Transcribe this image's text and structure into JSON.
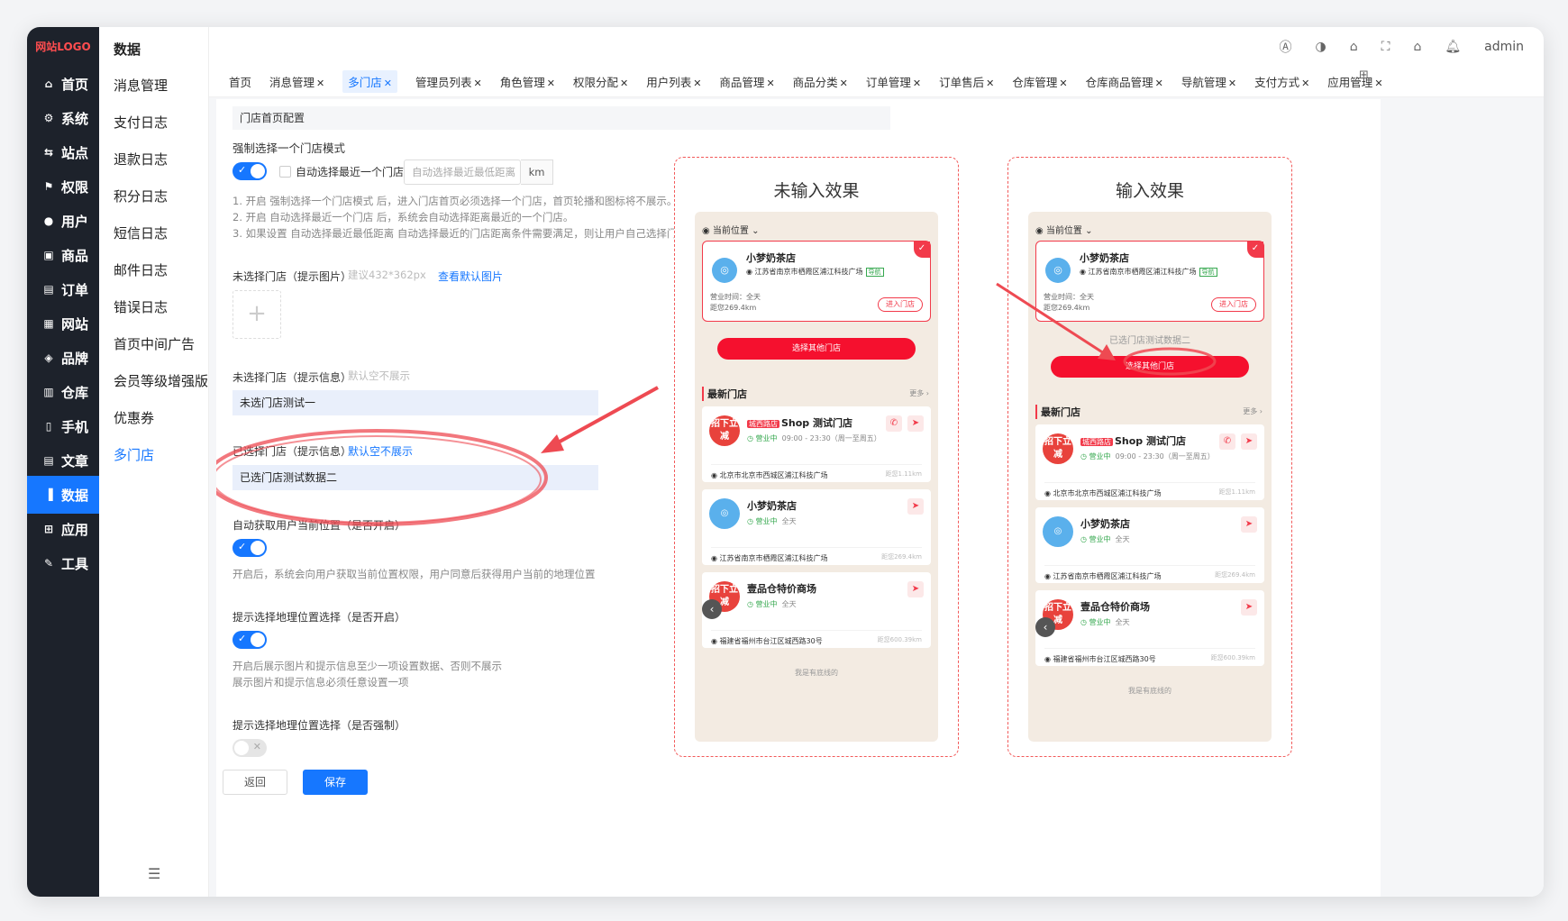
{
  "logo": "网站LOGO",
  "sidebar": {
    "items": [
      {
        "label": "首页",
        "icon": "home-icon"
      },
      {
        "label": "系统",
        "icon": "gear-icon"
      },
      {
        "label": "站点",
        "icon": "site-icon"
      },
      {
        "label": "权限",
        "icon": "permission-icon"
      },
      {
        "label": "用户",
        "icon": "user-icon"
      },
      {
        "label": "商品",
        "icon": "goods-icon"
      },
      {
        "label": "订单",
        "icon": "order-icon"
      },
      {
        "label": "网站",
        "icon": "website-icon"
      },
      {
        "label": "品牌",
        "icon": "brand-icon"
      },
      {
        "label": "仓库",
        "icon": "warehouse-icon"
      },
      {
        "label": "手机",
        "icon": "phone-icon"
      },
      {
        "label": "文章",
        "icon": "article-icon"
      },
      {
        "label": "数据",
        "icon": "chart-icon"
      },
      {
        "label": "应用",
        "icon": "apps-icon"
      },
      {
        "label": "工具",
        "icon": "wrench-icon"
      }
    ]
  },
  "submenu": {
    "title": "数据",
    "items": [
      "消息管理",
      "支付日志",
      "退款日志",
      "积分日志",
      "短信日志",
      "邮件日志",
      "错误日志",
      "首页中间广告",
      "会员等级增强版",
      "优惠券",
      "多门店"
    ]
  },
  "header": {
    "user": "admin"
  },
  "tabs": [
    "首页",
    "消息管理",
    "多门店",
    "管理员列表",
    "角色管理",
    "权限分配",
    "用户列表",
    "商品管理",
    "商品分类",
    "订单管理",
    "订单售后",
    "仓库管理",
    "仓库商品管理",
    "导航管理",
    "支付方式",
    "应用管理"
  ],
  "form": {
    "section_title": "门店首页配置",
    "force_label": "强制选择一个门店模式",
    "auto_nearest_label": "自动选择最近一个门店",
    "distance_placeholder": "自动选择最近最低距离",
    "distance_unit": "km",
    "notes": [
      "1. 开启 强制选择一个门店模式 后，进入门店首页必须选择一个门店，首页轮播和图标将不展示。",
      "2. 开启 自动选择最近一个门店 后，系统会自动选择距离最近的一个门店。",
      "3. 如果设置 自动选择最近最低距离 自动选择最近的门店距离条件需要满足，则让用户自己选择门店。"
    ],
    "unselected_image_label": "未选择门店（提示图片）",
    "unselected_image_hint": "建议432*362px",
    "view_default_image": "查看默认图片",
    "unselected_info_label": "未选择门店（提示信息）",
    "unselected_info_hint": "默认空不展示",
    "unselected_info_value": "未选门店测试一",
    "selected_info_label": "已选择门店（提示信息）",
    "selected_info_hint": "默认空不展示",
    "selected_info_value": "已选门店测试数据二",
    "auto_location_label": "自动获取用户当前位置（是否开启）",
    "auto_location_note": "开启后，系统会向用户获取当前位置权限，用户同意后获得用户当前的地理位置",
    "prompt_location_label": "提示选择地理位置选择（是否开启）",
    "prompt_location_note1": "开启后展示图片和提示信息至少一项设置数据、否则不展示",
    "prompt_location_note2": "展示图片和提示信息必须任意设置一项",
    "prompt_force_label": "提示选择地理位置选择（是否强制）",
    "back_button": "返回",
    "save_button": "保存"
  },
  "preview": {
    "left_title": "未输入效果",
    "right_title": "输入效果",
    "current_location": "当前位置",
    "selected_store": {
      "name": "小梦奶茶店",
      "address": "江苏省南京市栖霞区浦江科技广场",
      "nav_tag": "导航",
      "hours": "营业时间：全天",
      "distance": "距您269.4km",
      "enter": "进入门店"
    },
    "selected_hint_text": "已选门店测试数据二",
    "select_other": "选择其他门店",
    "latest_title": "最新门店",
    "more": "更多",
    "stores": [
      {
        "badge": "城西路店",
        "name": "Shop 测试门店",
        "status": "营业中",
        "hours": "09:00 - 23:30（周一至周五）",
        "address": "北京市北京市西城区浦江科技广场",
        "distance": "距您1.11km",
        "img": "招下立减"
      },
      {
        "badge": "",
        "name": "小梦奶茶店",
        "status": "营业中",
        "hours": "全天",
        "address": "江苏省南京市栖霞区浦江科技广场",
        "distance": "距您269.4km",
        "img": ""
      },
      {
        "badge": "",
        "name": "壹品仓特价商场",
        "status": "营业中",
        "hours": "全天",
        "address": "福建省福州市台江区城西路30号",
        "distance": "距您600.39km",
        "img": "招下立减"
      }
    ],
    "bottom_line": "我是有底线的"
  },
  "colors": {
    "primary": "#1677ff",
    "sidebar_bg": "#1d222b",
    "accent_red": "#f23a4a",
    "annotation_red": "#ee4a52"
  }
}
